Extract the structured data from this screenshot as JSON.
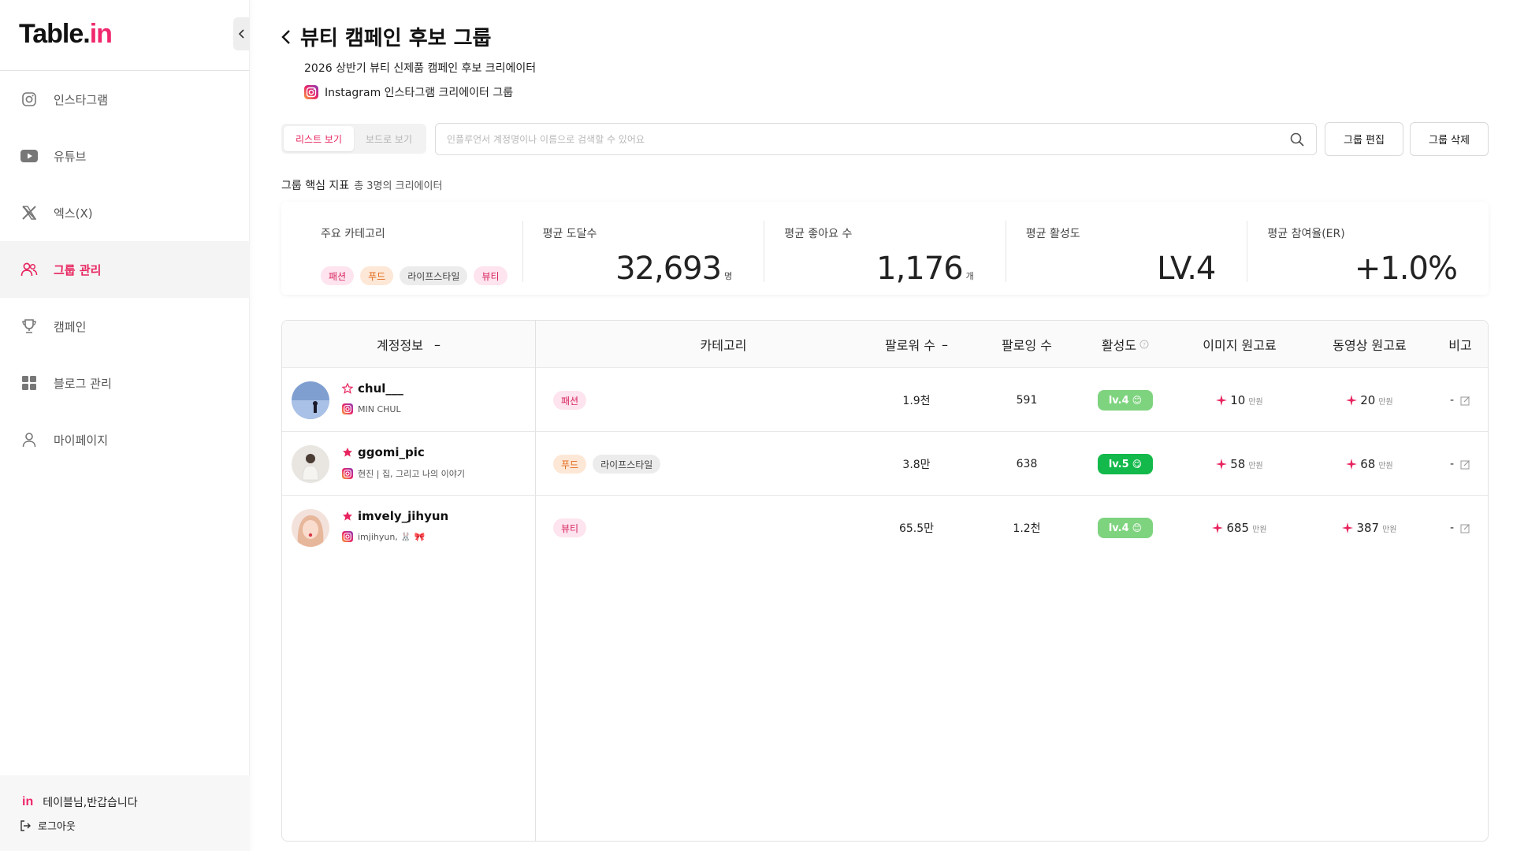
{
  "app": {
    "logo_main": "Table.",
    "logo_accent": "in",
    "brand_color": "#f0276d"
  },
  "sidebar": {
    "items": [
      {
        "label": "인스타그램",
        "icon": "instagram-icon"
      },
      {
        "label": "유튜브",
        "icon": "youtube-icon"
      },
      {
        "label": "엑스(X)",
        "icon": "x-icon"
      },
      {
        "label": "그룹 관리",
        "icon": "users-icon",
        "active": true
      },
      {
        "label": "캠페인",
        "icon": "trophy-icon"
      },
      {
        "label": "블로그 관리",
        "icon": "grid-icon"
      },
      {
        "label": "마이페이지",
        "icon": "user-icon"
      }
    ],
    "footer": {
      "brand_mark": "in",
      "greeting": "테이블님,반갑습니다",
      "logout": "로그아웃"
    }
  },
  "header": {
    "title": "뷰티 캠페인 후보 그룹",
    "subtitle": "2026 상반기 뷰티 신제품 캠페인 후보 크리에이터",
    "platform": "Instagram 인스타그램 크리에이터 그룹"
  },
  "toolbar": {
    "view_list": "리스트 보기",
    "view_board": "보드로 보기",
    "search_placeholder": "인플루언서 계정명이나 이름으로 검색할 수 있어요",
    "edit_group": "그룹 편집",
    "delete_group": "그룹 삭제"
  },
  "kpi": {
    "heading": "그룹 핵심 지표",
    "heading_sub": "총 3명의 크리에이터",
    "main_category_label": "주요 카테고리",
    "main_categories": [
      "패션",
      "푸드",
      "라이프스타일",
      "뷰티"
    ],
    "avg_reach_label": "평균 도달수",
    "avg_reach_value": "32,693",
    "avg_reach_unit": "명",
    "avg_likes_label": "평균 좋아요 수",
    "avg_likes_value": "1,176",
    "avg_likes_unit": "개",
    "avg_activity_label": "평균 활성도",
    "avg_activity_value": "LV.4",
    "avg_er_label": "평균 참여율(ER)",
    "avg_er_value": "+1.0%"
  },
  "table": {
    "headers": {
      "account": "계정정보",
      "category": "카테고리",
      "followers": "팔로워 수",
      "following": "팔로잉 수",
      "activity": "활성도",
      "image_fee": "이미지 원고료",
      "video_fee": "동영상 원고료",
      "remark": "비고"
    },
    "rows": [
      {
        "handle": "chul___",
        "bio": "MIN CHUL",
        "starred": false,
        "categories": [
          {
            "label": "패션",
            "style": "pink"
          }
        ],
        "followers": "1.9천",
        "following": "591",
        "level": "lv.4",
        "level_face": "😊",
        "image_fee": "10",
        "video_fee": "20",
        "fee_unit": "만원",
        "remark": "-"
      },
      {
        "handle": "ggomi_pic",
        "bio": "현진 | 집, 그리고 나의 이야기",
        "starred": true,
        "categories": [
          {
            "label": "푸드",
            "style": "orange"
          },
          {
            "label": "라이프스타일",
            "style": "gray"
          }
        ],
        "followers": "3.8만",
        "following": "638",
        "level": "lv.5",
        "level_face": "😋",
        "image_fee": "58",
        "video_fee": "68",
        "fee_unit": "만원",
        "remark": "-"
      },
      {
        "handle": "imvely_jihyun",
        "bio": "imjihyun, 🐰 🎀",
        "starred": true,
        "categories": [
          {
            "label": "뷰티",
            "style": "pink"
          }
        ],
        "followers": "65.5만",
        "following": "1.2천",
        "level": "lv.4",
        "level_face": "😊",
        "image_fee": "685",
        "video_fee": "387",
        "fee_unit": "만원",
        "remark": "-"
      }
    ]
  }
}
